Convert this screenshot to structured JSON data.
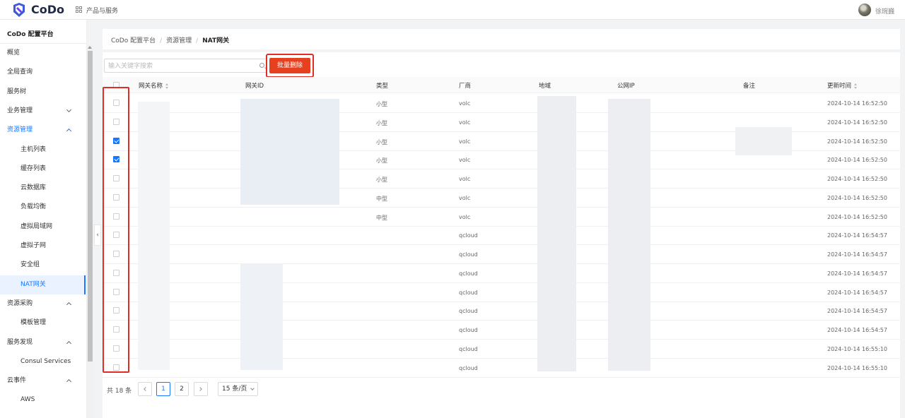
{
  "topbar": {
    "brand": "CoDo",
    "products_label": "产品与服务",
    "username": "徐琬巍"
  },
  "sidebar": {
    "title": "CoDo 配置平台",
    "items": [
      {
        "label": "概览",
        "level": 1,
        "state": ""
      },
      {
        "label": "全局查询",
        "level": 1,
        "state": ""
      },
      {
        "label": "服务树",
        "level": 1,
        "state": ""
      },
      {
        "label": "业务管理",
        "level": 1,
        "state": "collapsed"
      },
      {
        "label": "资源管理",
        "level": 1,
        "state": "expanded-active"
      },
      {
        "label": "主机列表",
        "level": 2,
        "state": ""
      },
      {
        "label": "缓存列表",
        "level": 2,
        "state": ""
      },
      {
        "label": "云数据库",
        "level": 2,
        "state": ""
      },
      {
        "label": "负载均衡",
        "level": 2,
        "state": ""
      },
      {
        "label": "虚拟局域网",
        "level": 2,
        "state": ""
      },
      {
        "label": "虚拟子网",
        "level": 2,
        "state": ""
      },
      {
        "label": "安全组",
        "level": 2,
        "state": ""
      },
      {
        "label": "NAT网关",
        "level": 2,
        "state": "active"
      },
      {
        "label": "资源采购",
        "level": 1,
        "state": "expanded"
      },
      {
        "label": "模板管理",
        "level": 2,
        "state": ""
      },
      {
        "label": "服务发现",
        "level": 1,
        "state": "expanded"
      },
      {
        "label": "Consul Services",
        "level": 2,
        "state": ""
      },
      {
        "label": "云事件",
        "level": 1,
        "state": "expanded"
      },
      {
        "label": "AWS",
        "level": 2,
        "state": ""
      }
    ]
  },
  "breadcrumb": [
    "CoDo 配置平台",
    "资源管理",
    "NAT网关"
  ],
  "toolbar": {
    "search_placeholder": "输入关键字搜索",
    "batch_delete_label": "批量删除"
  },
  "table": {
    "columns": {
      "name": "网关名称",
      "id": "网关ID",
      "type": "类型",
      "vendor": "厂商",
      "region": "地域",
      "public_ip": "公网IP",
      "remark": "备注",
      "updated": "更新时间"
    },
    "rows": [
      {
        "checked": false,
        "type": "小型",
        "vendor": "volc",
        "updated": "2024-10-14 16:52:50"
      },
      {
        "checked": false,
        "type": "小型",
        "vendor": "volc",
        "updated": "2024-10-14 16:52:50"
      },
      {
        "checked": true,
        "type": "小型",
        "vendor": "volc",
        "updated": "2024-10-14 16:52:50"
      },
      {
        "checked": true,
        "type": "小型",
        "vendor": "volc",
        "updated": "2024-10-14 16:52:50"
      },
      {
        "checked": false,
        "type": "小型",
        "vendor": "volc",
        "updated": "2024-10-14 16:52:50"
      },
      {
        "checked": false,
        "type": "中型",
        "vendor": "volc",
        "updated": "2024-10-14 16:52:50"
      },
      {
        "checked": false,
        "type": "中型",
        "vendor": "volc",
        "updated": "2024-10-14 16:52:50"
      },
      {
        "checked": false,
        "type": "",
        "vendor": "qcloud",
        "updated": "2024-10-14 16:54:57"
      },
      {
        "checked": false,
        "type": "",
        "vendor": "qcloud",
        "updated": "2024-10-14 16:54:57"
      },
      {
        "checked": false,
        "type": "",
        "vendor": "qcloud",
        "updated": "2024-10-14 16:54:57"
      },
      {
        "checked": false,
        "type": "",
        "vendor": "qcloud",
        "updated": "2024-10-14 16:54:57"
      },
      {
        "checked": false,
        "type": "",
        "vendor": "qcloud",
        "updated": "2024-10-14 16:54:57"
      },
      {
        "checked": false,
        "type": "",
        "vendor": "qcloud",
        "updated": "2024-10-14 16:54:57"
      },
      {
        "checked": false,
        "type": "",
        "vendor": "qcloud",
        "updated": "2024-10-14 16:55:10"
      },
      {
        "checked": false,
        "type": "",
        "vendor": "qcloud",
        "updated": "2024-10-14 16:55:10"
      }
    ]
  },
  "pagination": {
    "total_label": "共 18 条",
    "pages": [
      "1",
      "2"
    ],
    "current": "1",
    "page_size_label": "15 条/页"
  }
}
